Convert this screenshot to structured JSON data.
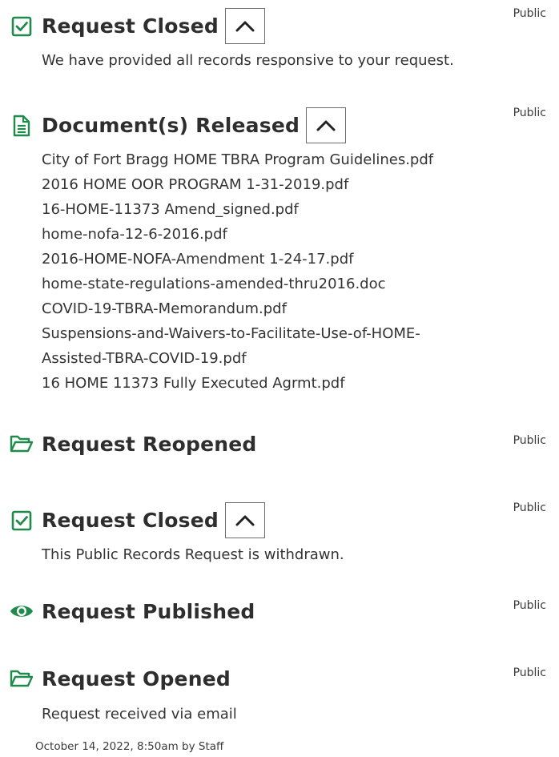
{
  "events": {
    "closed_1": {
      "icon": "checkbox-checked-icon",
      "title": "Request Closed",
      "visibility": "Public",
      "message": "We have provided all records responsive to your request."
    },
    "released": {
      "icon": "document-icon",
      "title": "Document(s) Released",
      "visibility": "Public",
      "documents": [
        "City of Fort Bragg HOME TBRA Program Guidelines.pdf",
        "2016 HOME OOR PROGRAM 1-31-2019.pdf",
        "16-HOME-11373 Amend_signed.pdf",
        "home-nofa-12-6-2016.pdf",
        "2016-HOME-NOFA-Amendment 1-24-17.pdf",
        "home-state-regulations-amended-thru2016.doc",
        "COVID-19-TBRA-Memorandum.pdf",
        "Suspensions-and-Waivers-to-Facilitate-Use-of-HOME-",
        "Assisted-TBRA-COVID-19.pdf",
        "16 HOME 11373 Fully Executed Agrmt.pdf"
      ]
    },
    "reopened": {
      "icon": "folder-open-icon",
      "title": "Request Reopened",
      "visibility": "Public"
    },
    "closed_2": {
      "icon": "checkbox-checked-icon",
      "title": "Request Closed",
      "visibility": "Public",
      "message": "This Public Records Request is withdrawn."
    },
    "published": {
      "icon": "eye-icon",
      "title": "Request Published",
      "visibility": "Public"
    },
    "opened": {
      "icon": "folder-open-icon",
      "title": "Request Opened",
      "visibility": "Public",
      "message": "Request received via email"
    }
  },
  "footer": {
    "meta": "October 14, 2022, 8:50am by Staff"
  },
  "colors": {
    "accent": "#1f8a4c",
    "text": "#2e2e2e",
    "border": "#6c6c6c"
  }
}
